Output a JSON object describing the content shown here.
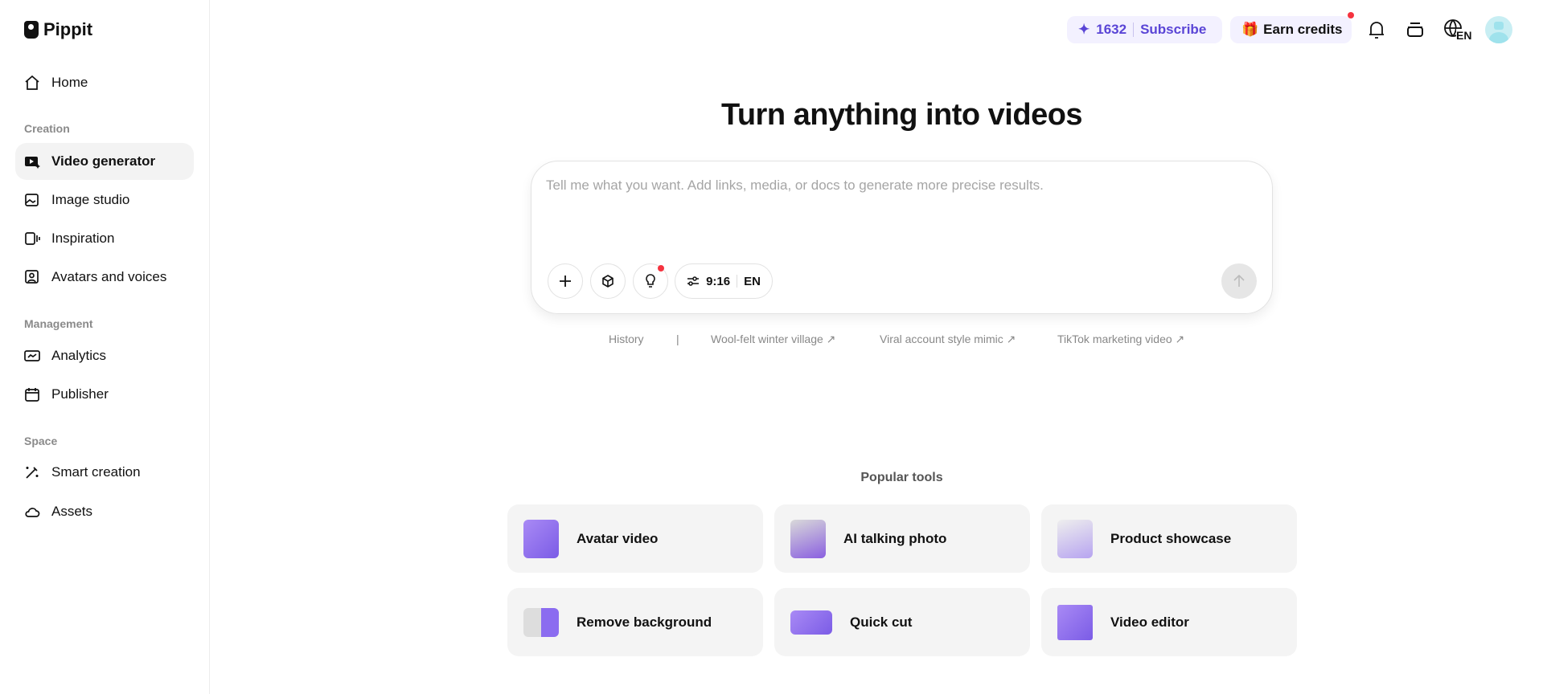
{
  "app": {
    "name": "Pippit"
  },
  "sidebar": {
    "home": "Home",
    "sections": [
      {
        "label": "Creation",
        "items": [
          "Video generator",
          "Image studio",
          "Inspiration",
          "Avatars and voices"
        ]
      },
      {
        "label": "Management",
        "items": [
          "Analytics",
          "Publisher"
        ]
      },
      {
        "label": "Space",
        "items": [
          "Smart creation",
          "Assets"
        ]
      }
    ],
    "active": "Video generator"
  },
  "topbar": {
    "credits": "1632",
    "subscribe": "Subscribe",
    "earn_credits": "Earn credits",
    "language": "EN"
  },
  "main": {
    "title": "Turn anything into videos",
    "prompt_placeholder": "Tell me what you want. Add links, media, or docs to generate more precise results.",
    "prompt_value": "",
    "aspect_ratio": "9:16",
    "language": "EN",
    "suggestions": {
      "history": "History",
      "separator": "|",
      "items": [
        "Wool-felt winter village ↗",
        "Viral account style mimic ↗",
        "TikTok marketing video ↗"
      ]
    },
    "popular_tools_label": "Popular tools",
    "tools": [
      "Avatar video",
      "AI talking photo",
      "Product showcase",
      "Remove background",
      "Quick cut",
      "Video editor"
    ]
  },
  "colors": {
    "accent": "#5a45d6",
    "notification": "#f5333f",
    "card_bg": "#f4f4f4"
  }
}
